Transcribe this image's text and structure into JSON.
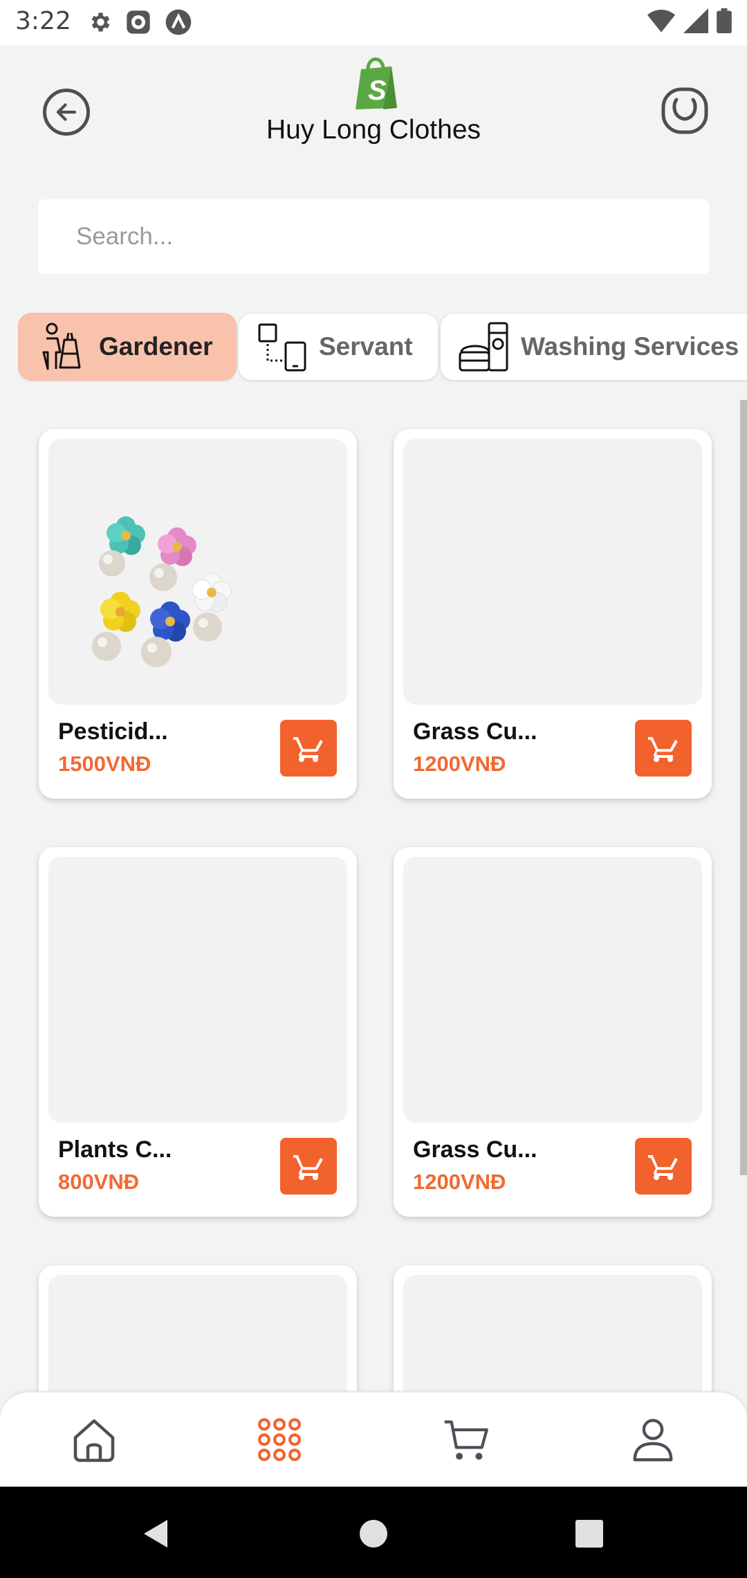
{
  "status_bar": {
    "time": "3:22"
  },
  "header": {
    "title": "Huy Long Clothes"
  },
  "search": {
    "placeholder": "Search..."
  },
  "categories": [
    {
      "label": "Gardener",
      "active": true
    },
    {
      "label": "Servant",
      "active": false
    },
    {
      "label": "Washing Services",
      "active": false
    }
  ],
  "products": [
    {
      "name": "Pesticid...",
      "price": "1500VNĐ"
    },
    {
      "name": "Grass Cu...",
      "price": "1200VNĐ"
    },
    {
      "name": "Plants C...",
      "price": "800VNĐ"
    },
    {
      "name": "Grass Cu...",
      "price": "1200VNĐ"
    }
  ],
  "bottom_nav": {
    "items": [
      "home-icon",
      "grid-icon",
      "cart-icon",
      "profile-icon"
    ],
    "active": "grid-icon"
  },
  "colors": {
    "accent": "#f1622d",
    "price": "#f06a32",
    "active_category": "#f9c2ad",
    "logo_green": "#5aa843"
  }
}
